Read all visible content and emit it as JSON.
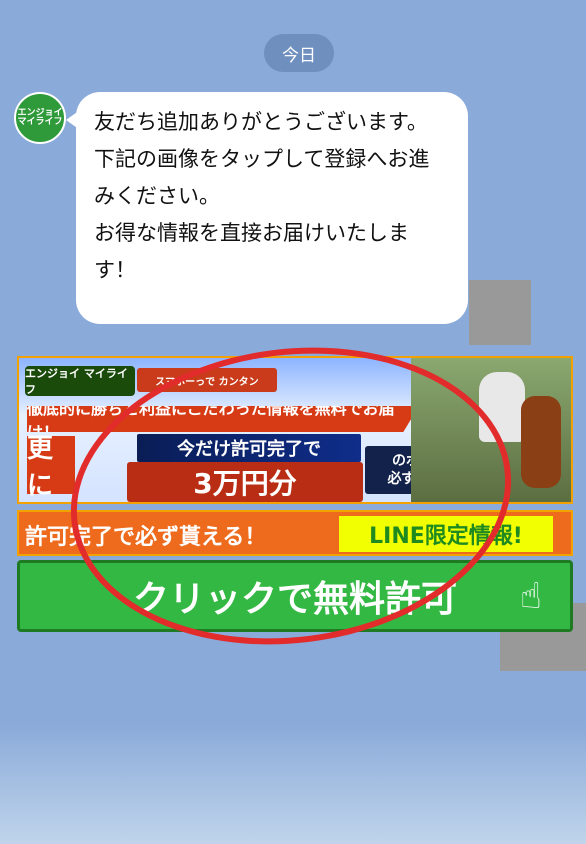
{
  "date_pill": "今日",
  "avatar": {
    "top": "エンジョイ",
    "middle": "マイライフ"
  },
  "message": "友だち追加ありがとうございます。\n下記の画像をタップして登録へお進みください。\nお得な情報を直接お届けいたします！",
  "banner": {
    "brand": "エンジョイ マイライフ",
    "subtitle": "スマホーっで カンタン",
    "topline": "徹底的に勝ちと利益にこだわった情報を無料でお届け！",
    "left_tag": "更に",
    "note": "今だけ許可完了で",
    "big_offer": "3万円分",
    "point_line1": "のポイントが",
    "point_line2": "必ず貰えます♪"
  },
  "strip": {
    "left": "許可完了で必ず貰える！",
    "right": "LINE限定情報!"
  },
  "cta": {
    "label": "クリックで無料許可"
  }
}
